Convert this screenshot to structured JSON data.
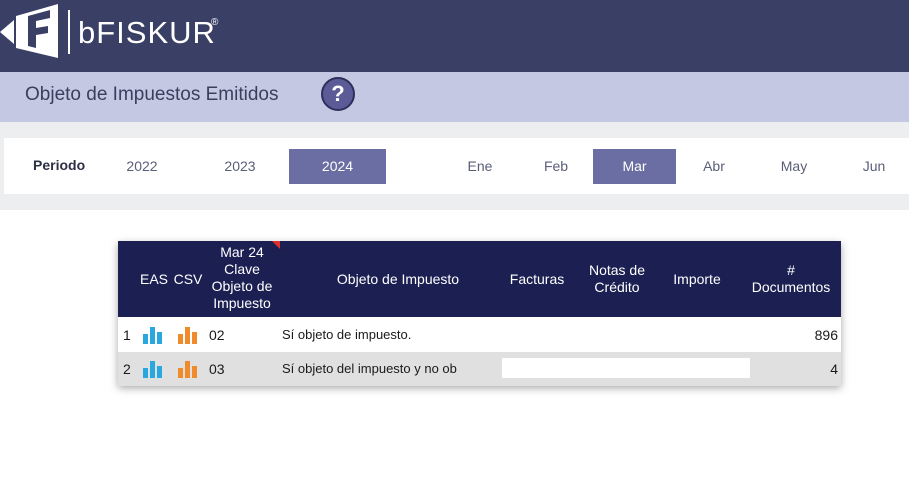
{
  "brand": {
    "name": "bFISKUR",
    "reg_mark": "®"
  },
  "page": {
    "title": "Objeto de Impuestos Emitidos",
    "help_label": "?"
  },
  "period": {
    "label": "Periodo",
    "years": [
      "2022",
      "2023",
      "2024"
    ],
    "selected_year": "2024",
    "months": [
      "Ene",
      "Feb",
      "Mar",
      "Abr",
      "May",
      "Jun"
    ],
    "selected_month": "Mar"
  },
  "table": {
    "headers": {
      "eas": "EAS",
      "csv": "CSV",
      "clave_line1": "Mar 24",
      "clave_line2": "Clave",
      "clave_line3": "Objeto de",
      "clave_line4": "Impuesto",
      "objeto": "Objeto de Impuesto",
      "facturas": "Facturas",
      "notas_line1": "Notas de",
      "notas_line2": "Crédito",
      "importe": "Importe",
      "docs_line1": "#",
      "docs_line2": "Documentos"
    },
    "rows": [
      {
        "index": "1",
        "clave": "02",
        "objeto": "Sí objeto de impuesto.",
        "facturas": "",
        "notas": "",
        "importe": "",
        "documentos": "896"
      },
      {
        "index": "2",
        "clave": "03",
        "objeto": "Sí objeto del impuesto y no ob",
        "facturas": "",
        "notas": "",
        "importe": "",
        "documentos": "4"
      }
    ],
    "icons": {
      "eas": "bar-chart-icon",
      "csv": "bar-chart-icon"
    }
  },
  "colors": {
    "header_bg": "#3a3f66",
    "title_bar_bg": "#c5c8e3",
    "active_pill": "#6b6ea2",
    "table_header_bg": "#1b1f52",
    "eas_icon": "#29a8e0",
    "csv_icon": "#f08a2a"
  }
}
